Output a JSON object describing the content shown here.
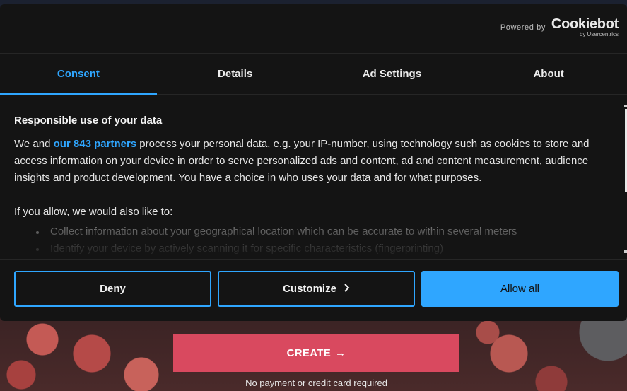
{
  "background": {
    "cta_label": "CREATE",
    "cta_icon": "arrow-right-icon",
    "note": "No payment or credit card required"
  },
  "dialog": {
    "powered_by": "Powered by",
    "logo_main": "Cookiebot",
    "logo_sub": "by Usercentrics",
    "tabs": [
      {
        "label": "Consent",
        "active": true
      },
      {
        "label": "Details",
        "active": false
      },
      {
        "label": "Ad Settings",
        "active": false
      },
      {
        "label": "About",
        "active": false
      }
    ],
    "content": {
      "heading": "Responsible use of your data",
      "intro_before": "We and ",
      "partners_link": "our 843 partners",
      "intro_after": " process your personal data, e.g. your IP-number, using technology such as cookies to store and access information on your device in order to serve personalized ads and content, ad and content measurement, audience insights and product development. You have a choice in who uses your data and for what purposes.",
      "also_like": "If you allow, we would also like to:",
      "bullets": [
        "Collect information about your geographical location which can be accurate to within several meters",
        "Identify your device by actively scanning it for specific characteristics (fingerprinting)"
      ]
    },
    "buttons": {
      "deny": "Deny",
      "customize": "Customize",
      "customize_icon": "chevron-right-icon",
      "allow_all": "Allow all"
    }
  },
  "colors": {
    "accent": "#2fa6ff",
    "dialog_bg": "#141414",
    "cta": "#d9495f"
  }
}
